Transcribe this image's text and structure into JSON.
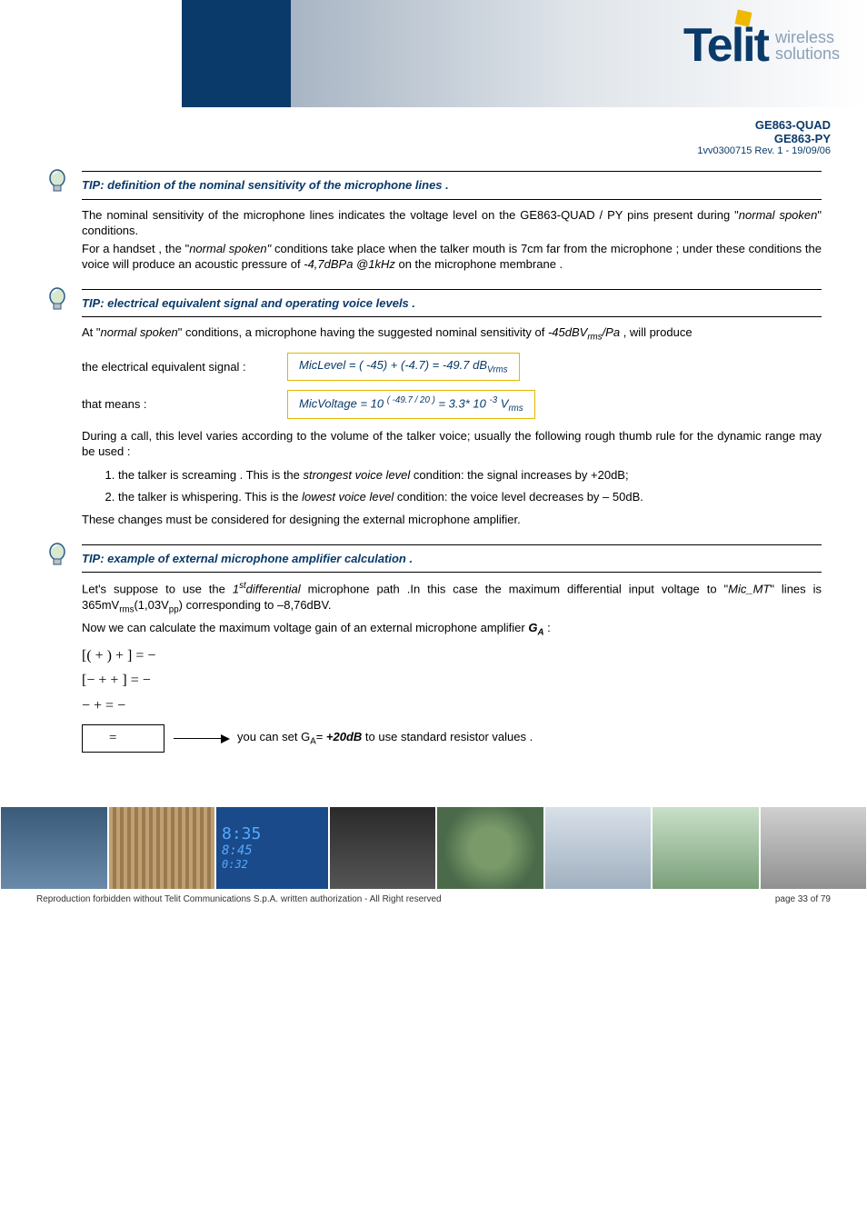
{
  "logo": {
    "brand": "Telit",
    "sub1": "wireless",
    "sub2": "solutions"
  },
  "doc": {
    "model1": "GE863-QUAD",
    "model2": "GE863-PY",
    "rev": "1vv0300715 Rev. 1 - 19/09/06"
  },
  "tip1": {
    "title": "TIP:  definition of  the nominal sensitivity of the microphone lines ."
  },
  "p1": "The nominal sensitivity of the microphone lines indicates the voltage level on the GE863-QUAD / PY pins present during \"",
  "p1_i": "normal spoken",
  "p1_end": "\" conditions.",
  "p2a": "For a handset , the \"",
  "p2_i1": "normal spoken\"",
  "p2b": "  conditions take place when the talker mouth is 7cm far from the microphone ; under these conditions the voice will produce an acoustic pressure of ",
  "p2_i2": "-4,7dBPa @1kHz",
  "p2c": " on the microphone membrane .",
  "tip2": {
    "title": "TIP:  electrical equivalent signal and operating voice levels ."
  },
  "p3a": "At \"",
  "p3_i1": "normal spoken",
  "p3b": "\" conditions, a microphone having the suggested nominal sensitivity of ",
  "p3_i2": "-45dBV",
  "p3_sub": "rms",
  "p3_i3": "/Pa",
  "p3c": " , will produce",
  "f1": {
    "label": " the electrical equivalent signal  :",
    "formula_pre": "MicLevel  = ( -45) + (-4.7) = -49.7 dB",
    "formula_sub": "Vrms"
  },
  "f2": {
    "label": "that means   :",
    "formula_pre": "MicVoltage = 10 ",
    "formula_sup": "( -49.7 / 20 )",
    "formula_mid": " = 3.3* 10 ",
    "formula_sup2": "-3",
    "formula_post": " V",
    "formula_sub": "rms"
  },
  "p4": "During a call, this level varies according to the volume of the talker voice; usually the following rough thumb rule for the dynamic range may be used :",
  "li1a": "the talker is screaming .  This is the ",
  "li1_i": "strongest voice level",
  "li1b": " condition: the signal increases by +20dB;",
  "li2a": "the talker is whispering.  This is the ",
  "li2_i": "lowest voice level",
  "li2b": " condition: the voice level decreases by – 50dB.",
  "p5": "These changes must be considered for designing the external microphone amplifier.",
  "tip3": {
    "title": "TIP:  example of  external microphone amplifier calculation  ."
  },
  "p6a": "Let's suppose to use the ",
  "p6_i1": "1",
  "p6_sup": "st",
  "p6_i2": "differential",
  "p6b": " microphone path .In this case the maximum differential input voltage to \"",
  "p6_i3": "Mic_MT",
  "p6c": "\" lines is 365mV",
  "p6_sub1": "rms",
  "p6d": "(1,03V",
  "p6_sub2": "pp",
  "p6e": ") corresponding to –8,76dBV.",
  "p7a": "Now we can calculate the maximum voltage gain of  an external microphone amplifier ",
  "p7_b": "G",
  "p7_sub": "A",
  "p7b": "  :",
  "eq1": "[(            +        ) +       ] = −",
  "eq2": "[−        +     +      ] = −",
  "eq3": "−        +       = −",
  "eq_final": "=",
  "eq_result_a": "you can set  G",
  "eq_result_sub": "A",
  "eq_result_b": "= ",
  "eq_result_bold": "+20dB",
  "eq_result_c": " to use standard resistor values .",
  "clock": {
    "l1": "8:35",
    "l2": "8:45",
    "l3": "0:32"
  },
  "footer": {
    "left": "Reproduction forbidden without Telit Communications S.p.A. written authorization - All Right reserved",
    "right": "page 33 of 79"
  }
}
